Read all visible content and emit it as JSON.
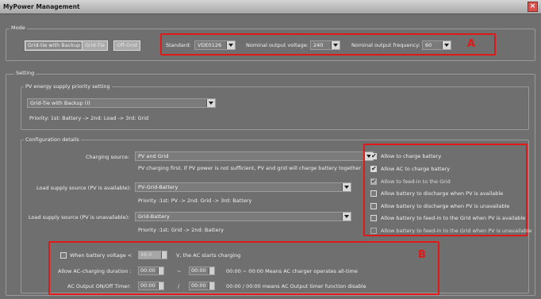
{
  "window": {
    "title": "MyPower Management",
    "close_glyph": "×"
  },
  "mode": {
    "legend": "Mode",
    "buttons": [
      "Grid-tie with Backup",
      "Grid-Tie",
      "Off-Grid"
    ],
    "standard_label": "Standard:",
    "standard_value": "VDE0126",
    "voltage_label": "Nominal output voltage:",
    "voltage_value": "240",
    "frequency_label": "Nominal output frequency:",
    "frequency_value": "60",
    "annotation": "A"
  },
  "setting": {
    "legend": "Setting",
    "pv_priority": {
      "legend": "PV energy supply priority setting",
      "selected": "Grid-Tie with Backup (I)",
      "priority_text": "Priority: 1st: Battery -> 2nd: Load -> 3rd: Grid"
    },
    "config": {
      "legend": "Configuration details",
      "charging_source_label": "Charging source:",
      "charging_source_value": "PV and Grid",
      "charging_source_note": "PV charging first. If PV power is not sufficient, PV and grid will charge battery together",
      "load_pv_available_label": "Load supply source (PV is available):",
      "load_pv_available_value": "PV-Grid-Battery",
      "load_pv_available_note": "Priority :1st: PV -> 2nd: Grid -> 3rd: Battery",
      "load_pv_unavailable_label": "Load supply source (PV is unavailable):",
      "load_pv_unavailable_value": "Grid-Battery",
      "load_pv_unavailable_note": "Priority :1st: Grid -> 2nd: Battery"
    },
    "options": [
      {
        "label": "Allow to charge battery",
        "checked": true,
        "enabled": true
      },
      {
        "label": "Allow AC to charge battery",
        "checked": true,
        "enabled": true
      },
      {
        "label": "Allow to feed-in to the Grid",
        "checked": true,
        "enabled": false
      },
      {
        "label": "Allow battery to discharge when PV is available",
        "checked": false,
        "enabled": true
      },
      {
        "label": "Allow battery to discharge when PV is unavailable",
        "checked": false,
        "enabled": true
      },
      {
        "label": "Allow battery to feed-in to the Grid when PV is available",
        "checked": false,
        "enabled": true
      },
      {
        "label": "Allow battery to feed-in to the Grid when PV is unavailable",
        "checked": false,
        "enabled": false
      }
    ],
    "annotation_b": "B",
    "battery": {
      "when_label": "When battery voltage <",
      "voltage_value": "48.0",
      "unit_text": "V,  the AC starts charging",
      "ac_duration_label": "Allow AC-charging duration :",
      "ac_start": "00:00",
      "dash": "~",
      "ac_end": "00:00",
      "ac_note": "00:00 ~ 00:00 Means AC charger operates all-time",
      "output_timer_label": "AC Output ON/Off Timer:",
      "out_start": "00:00",
      "slash": "/",
      "out_end": "00:00",
      "out_note": "00:00 / 00:00 means AC Output timer function disable"
    }
  }
}
